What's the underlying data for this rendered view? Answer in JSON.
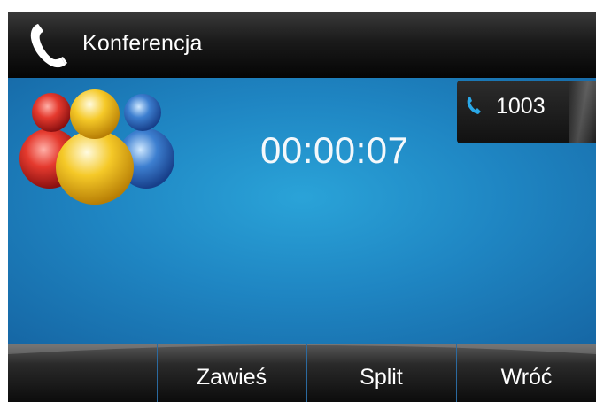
{
  "header": {
    "title": "Konferencja",
    "icon": "handset-icon"
  },
  "call": {
    "timer": "00:00:07",
    "participant": {
      "number": "1003",
      "icon": "phone-icon"
    },
    "conference_icon": "conference-users-icon"
  },
  "softkeys": [
    {
      "label": ""
    },
    {
      "label": "Zawieś"
    },
    {
      "label": "Split"
    },
    {
      "label": "Wróć"
    }
  ],
  "colors": {
    "screen_blue": "#1f86c3",
    "accent": "#1a8fd1",
    "header": "#111111"
  }
}
